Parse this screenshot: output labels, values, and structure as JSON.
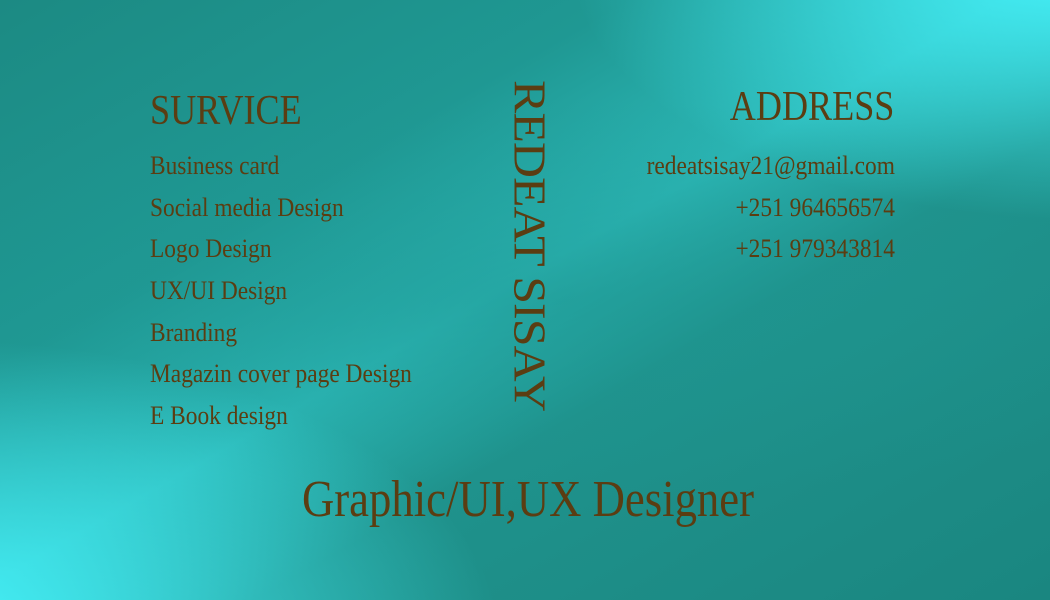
{
  "card": {
    "service_title": "SURVICE",
    "services": [
      "Business card",
      "Social media Design",
      "Logo Design",
      "UX/UI Design",
      "Branding",
      "Magazin cover page Design",
      "E Book design"
    ],
    "name": "REDEAT SISAY",
    "address_title": "ADDRESS",
    "contacts": [
      "redeatsisay21@gmail.com",
      "+251 964656574",
      "+251 979343814"
    ],
    "job_title": "Graphic/UI,UX Designer"
  },
  "colors": {
    "text": "#5b3d12",
    "background_dark": "#1c8a83",
    "background_light": "#48f6ff"
  }
}
